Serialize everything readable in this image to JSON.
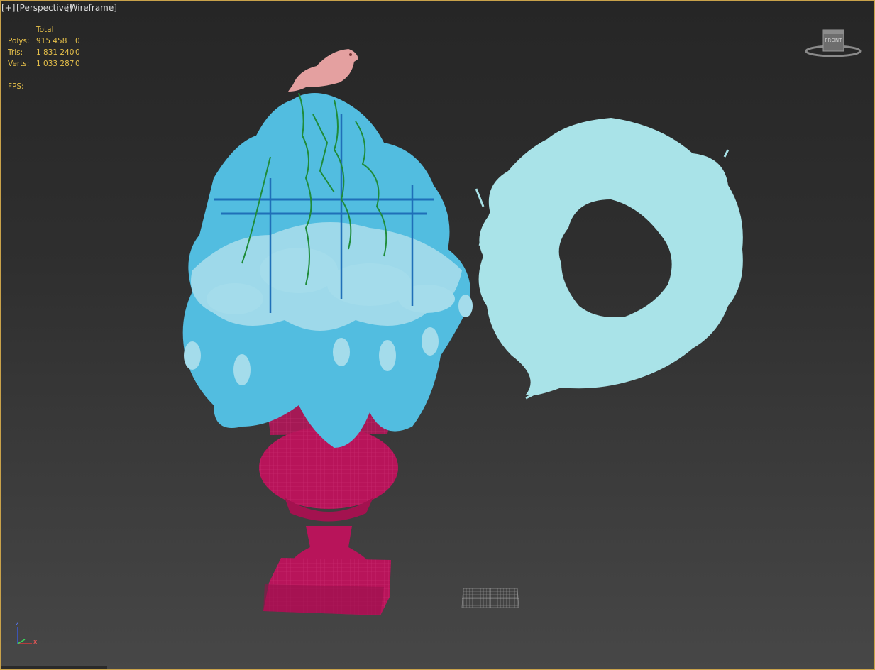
{
  "viewport": {
    "labels": {
      "plus": "[+]",
      "view": "[Perspective]",
      "shading": "[Wireframe]"
    },
    "stats": {
      "header": "Total",
      "rows": [
        {
          "name": "Polys:",
          "total": "915 458",
          "selected": "0"
        },
        {
          "name": "Tris:",
          "total": "1 831 240",
          "selected": "0"
        },
        {
          "name": "Verts:",
          "total": "1 033 287",
          "selected": "0"
        }
      ],
      "fps_label": "FPS:"
    },
    "viewcube_label": "FRONT",
    "axis": {
      "x": "x",
      "z": "z"
    }
  },
  "colors": {
    "frame_border": "#c9a24a",
    "stats_text": "#e6c04a",
    "urn": "#b8145a",
    "foliage": "#52bde0",
    "foliage_light": "#9ed9ea",
    "stems": "#1f8c3a",
    "bird": "#e4a0a0",
    "wreath": "#a9e3e8"
  }
}
